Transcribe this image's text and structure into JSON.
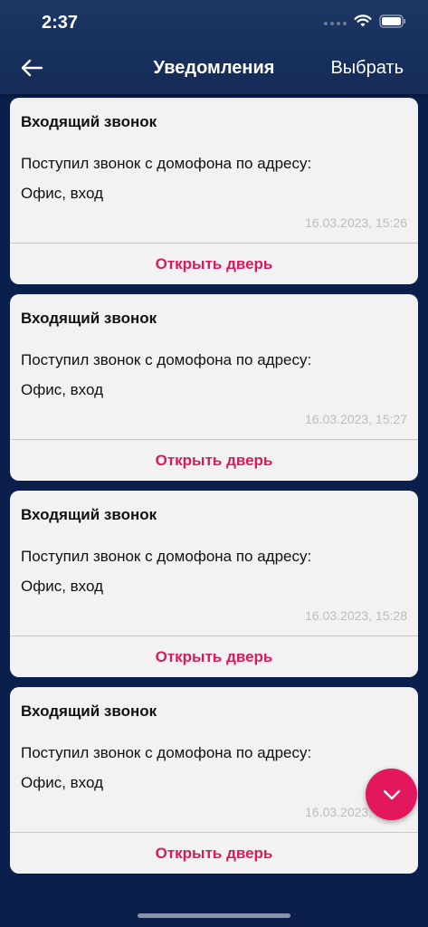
{
  "status_bar": {
    "time": "2:37"
  },
  "header": {
    "title": "Уведомления",
    "select_label": "Выбрать"
  },
  "notifications": [
    {
      "title": "Входящий звонок",
      "text": "Поступил звонок с домофона по адресу:",
      "address": "Офис, вход",
      "timestamp": "16.03.2023, 15:26",
      "action_label": "Открыть дверь"
    },
    {
      "title": "Входящий звонок",
      "text": "Поступил звонок с домофона по адресу:",
      "address": "Офис, вход",
      "timestamp": "16.03.2023, 15:27",
      "action_label": "Открыть дверь"
    },
    {
      "title": "Входящий звонок",
      "text": "Поступил звонок с домофона по адресу:",
      "address": "Офис, вход",
      "timestamp": "16.03.2023, 15:28",
      "action_label": "Открыть дверь"
    },
    {
      "title": "Входящий звонок",
      "text": "Поступил звонок с домофона по адресу:",
      "address": "Офис, вход",
      "timestamp": "16.03.2023, 15:29",
      "action_label": "Открыть дверь"
    }
  ],
  "icons": {
    "back": "arrow-left-icon",
    "scroll_down": "chevron-down-icon",
    "wifi": "wifi-icon",
    "battery": "battery-icon",
    "signal": "signal-icon"
  },
  "colors": {
    "accent": "#e2175e",
    "header_bg": "#1d3664",
    "page_bg": "#0b1f4d",
    "card_bg": "#f2f2f2"
  }
}
